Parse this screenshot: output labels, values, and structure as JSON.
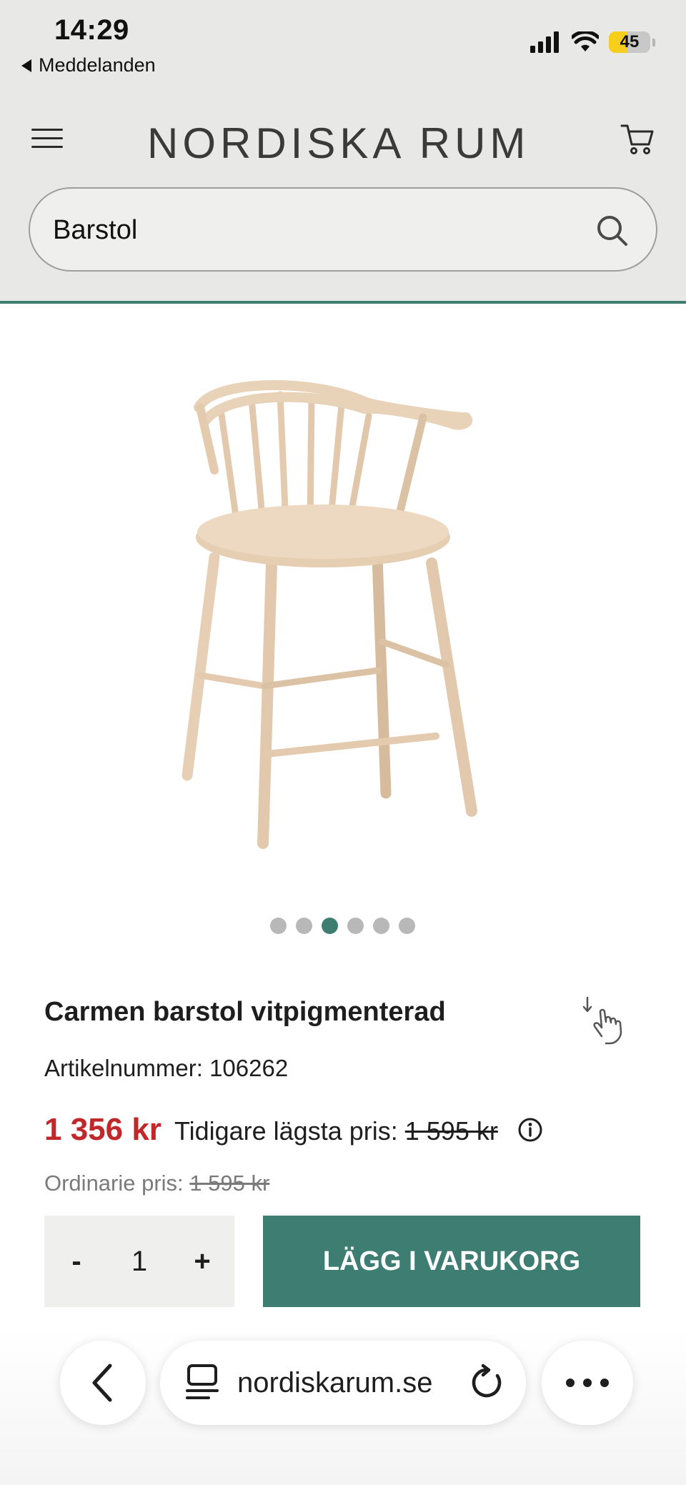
{
  "status_bar": {
    "time": "14:29",
    "back_app": "Meddelanden",
    "battery_level": "45"
  },
  "header": {
    "logo_text": "NORDISKA RUM",
    "menu_icon": "hamburger-menu-icon",
    "cart_icon": "shopping-cart-icon"
  },
  "search": {
    "value": "Barstol",
    "icon": "search-icon"
  },
  "gallery": {
    "image_count": 6,
    "active_index": 2
  },
  "product": {
    "title": "Carmen barstol vitpigmenterad",
    "article_label": "Artikelnummer:",
    "article_number": "106262",
    "price": "1 356 kr",
    "previous_lowest_label": "Tidigare lägsta pris:",
    "previous_lowest_price": "1 595 kr",
    "ordinary_label": "Ordinarie pris:",
    "ordinary_price": "1 595 kr"
  },
  "quantity": {
    "minus": "-",
    "value": "1",
    "plus": "+"
  },
  "add_to_cart_label": "LÄGG I VARUKORG",
  "browser": {
    "url": "nordiskarum.se",
    "back_icon": "chevron-left-icon",
    "reader_icon": "reader-mode-icon",
    "reload_icon": "reload-icon",
    "more_icon": "ellipsis-icon"
  },
  "colors": {
    "accent": "#3e7e72",
    "sale_price": "#c0282a",
    "header_bg": "#e8e8e6"
  }
}
